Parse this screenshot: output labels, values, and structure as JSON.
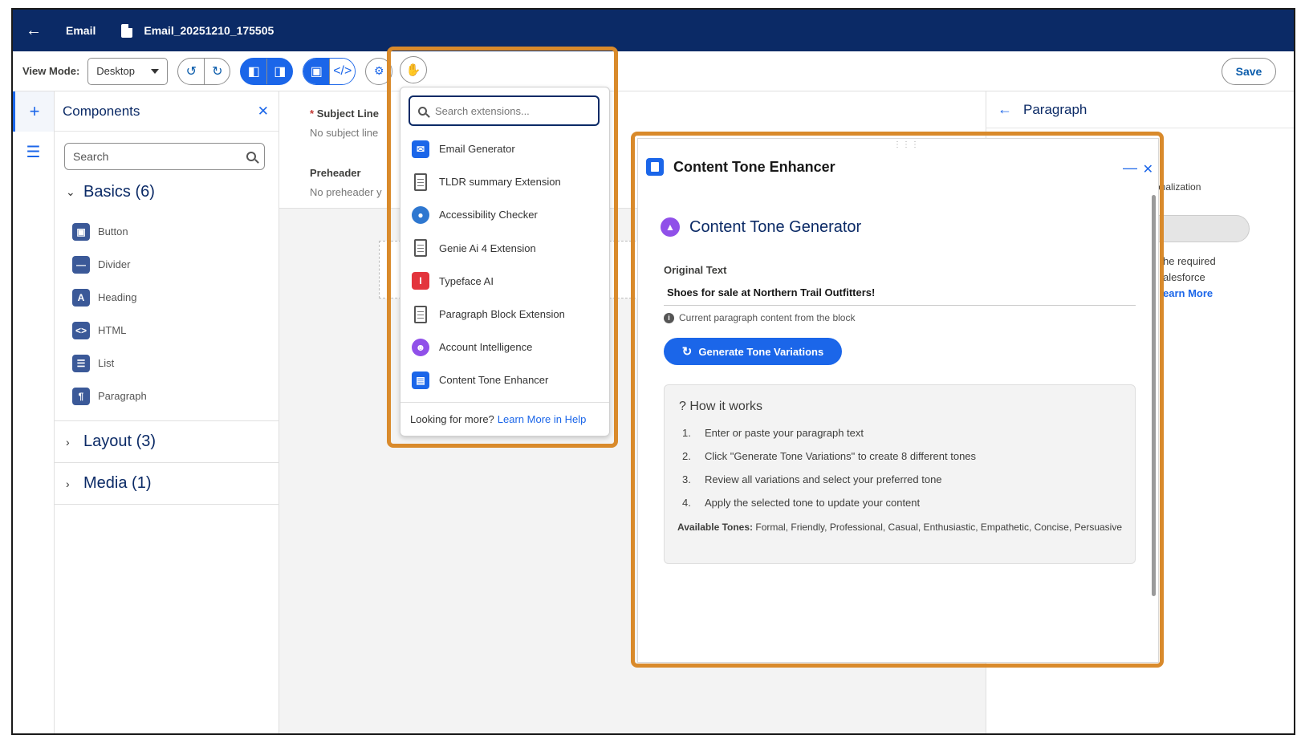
{
  "topbar": {
    "back_icon": "back-arrow-icon",
    "app_label": "Email",
    "doc_icon": "document-icon",
    "doc_name": "Email_20251210_175505"
  },
  "toolbar": {
    "view_mode_label": "View Mode:",
    "view_mode_value": "Desktop",
    "save_label": "Save"
  },
  "components_panel": {
    "title": "Components",
    "search_placeholder": "Search",
    "basics_label": "Basics (6)",
    "items": [
      {
        "label": "Button",
        "icon": "button-icon"
      },
      {
        "label": "Divider",
        "icon": "divider-icon"
      },
      {
        "label": "Heading",
        "icon": "heading-icon"
      },
      {
        "label": "HTML",
        "icon": "html-icon"
      },
      {
        "label": "List",
        "icon": "list-icon"
      },
      {
        "label": "Paragraph",
        "icon": "paragraph-icon"
      }
    ],
    "layout_label": "Layout (3)",
    "media_label": "Media (1)"
  },
  "canvas": {
    "subject_label": "Subject Line",
    "subject_value": "No subject line",
    "preheader_label": "Preheader",
    "preheader_value": "No preheader y"
  },
  "right_panel": {
    "title": "Paragraph",
    "personalization_fragment": "onalization",
    "line1": "he required",
    "line2": "alesforce",
    "learn_more": "earn More"
  },
  "extensions_menu": {
    "search_placeholder": "Search extensions...",
    "items": [
      {
        "label": "Email Generator",
        "icon": "email-generator-icon",
        "color": "#1b66e9"
      },
      {
        "label": "TLDR summary Extension",
        "icon": "clipboard-icon",
        "color": "#555555"
      },
      {
        "label": "Accessibility Checker",
        "icon": "accessibility-icon",
        "color": "#2e77d0"
      },
      {
        "label": "Genie Ai 4 Extension",
        "icon": "clipboard-icon",
        "color": "#555555"
      },
      {
        "label": "Typeface AI",
        "icon": "typeface-icon",
        "color": "#e3343c"
      },
      {
        "label": "Paragraph Block Extension",
        "icon": "clipboard-icon",
        "color": "#555555"
      },
      {
        "label": "Account Intelligence",
        "icon": "account-icon",
        "color": "#9050e9"
      },
      {
        "label": "Content Tone Enhancer",
        "icon": "content-tone-icon",
        "color": "#1b66e9"
      }
    ],
    "footer_text": "Looking for more?",
    "footer_link": "Learn More in Help"
  },
  "tone_enhancer": {
    "title": "Content Tone Enhancer",
    "generator_title": "Content Tone Generator",
    "original_label": "Original Text",
    "original_value": "Shoes for sale at Northern Trail Outfitters!",
    "help_text": "Current paragraph content from the block",
    "generate_button": "Generate Tone Variations",
    "how_title": "How it works",
    "steps": [
      "Enter or paste your paragraph text",
      "Click \"Generate Tone Variations\" to create 8 different tones",
      "Review all variations and select your preferred tone",
      "Apply the selected tone to update your content"
    ],
    "available_label": "Available Tones:",
    "available_value": "Formal, Friendly, Professional, Casual, Enthusiastic, Empathetic, Concise, Persuasive"
  },
  "colors": {
    "navy": "#0b2a66",
    "brand_blue": "#1b66e9",
    "highlight_orange": "#d98a2b"
  }
}
